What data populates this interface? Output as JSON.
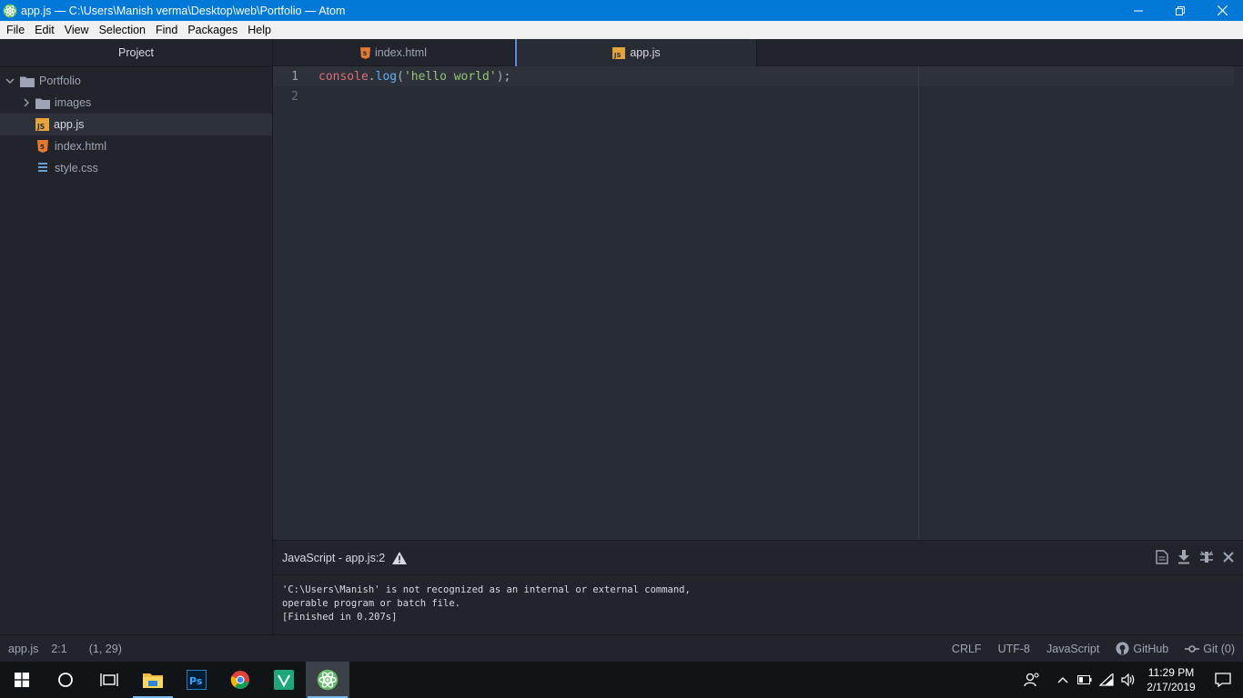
{
  "window": {
    "title": "app.js — C:\\Users\\Manish verma\\Desktop\\web\\Portfolio — Atom"
  },
  "menu": [
    "File",
    "Edit",
    "View",
    "Selection",
    "Find",
    "Packages",
    "Help"
  ],
  "sidebar": {
    "header": "Project",
    "root": "Portfolio",
    "items": [
      {
        "label": "images",
        "type": "folder"
      },
      {
        "label": "app.js",
        "type": "js"
      },
      {
        "label": "index.html",
        "type": "html"
      },
      {
        "label": "style.css",
        "type": "css"
      }
    ]
  },
  "tabs": [
    {
      "label": "index.html",
      "active": false
    },
    {
      "label": "app.js",
      "active": true
    }
  ],
  "editor": {
    "lines": [
      {
        "num": "1",
        "object": "console",
        "dot": ".",
        "fn": "log",
        "open": "(",
        "str": "'hello world'",
        "close": ");"
      },
      {
        "num": "2"
      }
    ]
  },
  "output": {
    "title": "JavaScript - app.js:2",
    "lines": [
      "'C:\\Users\\Manish' is not recognized as an internal or external command,",
      "operable program or batch file.",
      "[Finished in 0.207s]"
    ]
  },
  "status": {
    "file": "app.js",
    "cursor": "2:1",
    "selection": "(1, 29)",
    "line_ending": "CRLF",
    "encoding": "UTF-8",
    "grammar": "JavaScript",
    "github": "GitHub",
    "git": "Git (0)"
  },
  "taskbar": {
    "time": "11:29 PM",
    "date": "2/17/2019"
  },
  "colors": {
    "titlebar": "#0078d7",
    "accent": "#568af2",
    "js_icon": "#e5a33b",
    "html_icon": "#e37933",
    "css_icon": "#6a9fd4"
  }
}
